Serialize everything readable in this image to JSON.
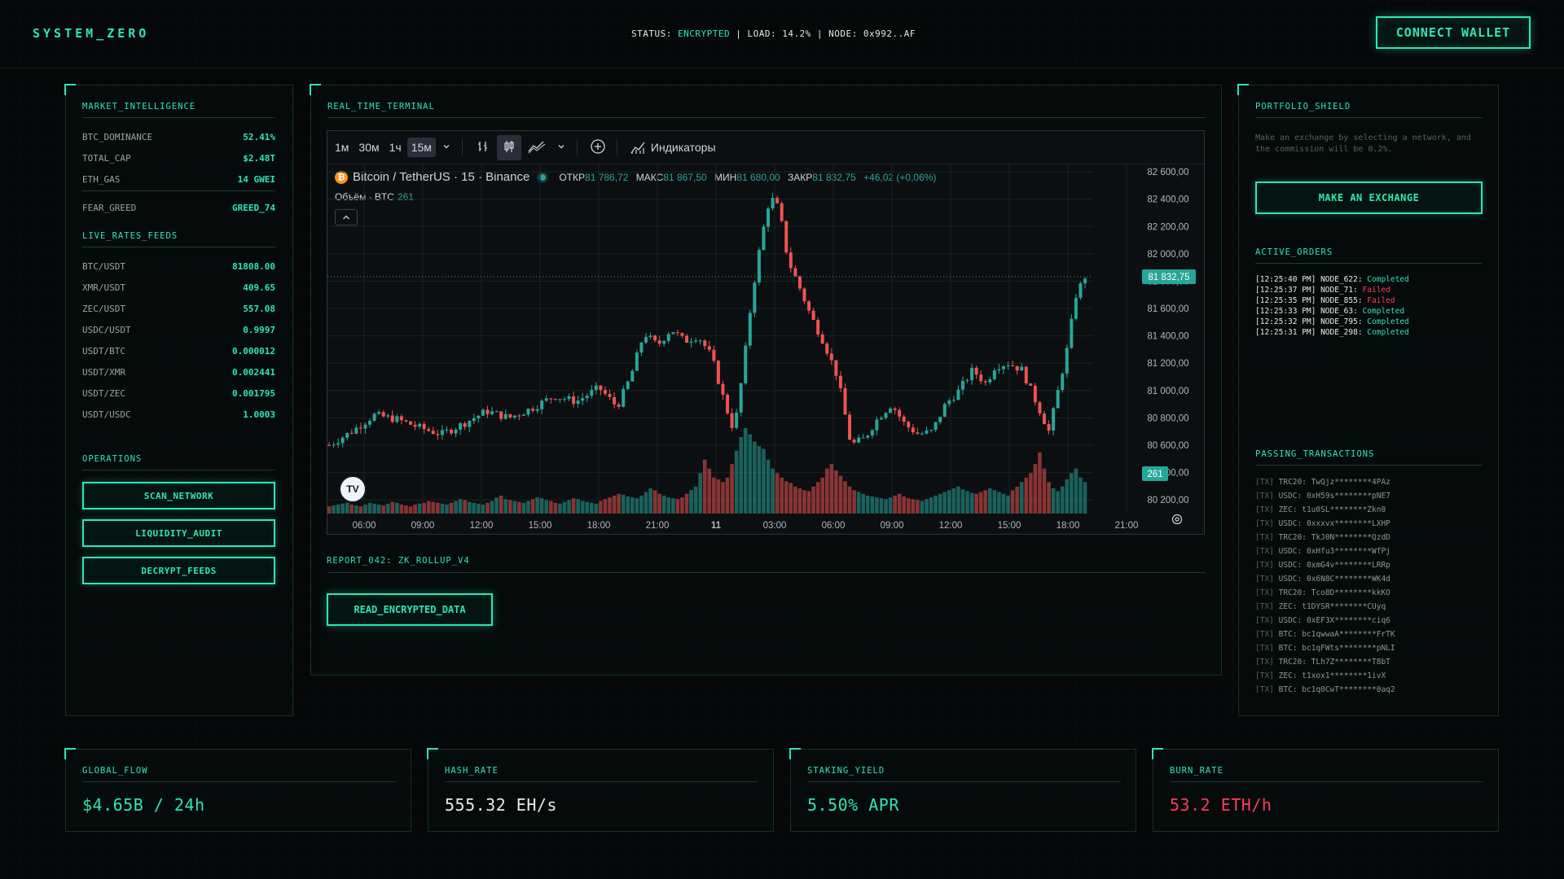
{
  "header": {
    "brand": "SYSTEM_ZERO",
    "status_prefix": "STATUS: ",
    "status_value": "ENCRYPTED",
    "status_suffix": " | LOAD: 14.2% | NODE: 0x992..AF",
    "connect_label": "CONNECT WALLET"
  },
  "left": {
    "market_title": "MARKET_INTELLIGENCE",
    "market_rows": [
      {
        "k": "BTC_DOMINANCE",
        "v": "52.41%"
      },
      {
        "k": "TOTAL_CAP",
        "v": "$2.48T"
      },
      {
        "k": "ETH_GAS",
        "v": "14 GWEI"
      },
      {
        "k": "FEAR_GREED",
        "v": "GREED_74"
      }
    ],
    "rates_title": "LIVE_RATES_FEEDS",
    "rates_rows": [
      {
        "k": "BTC/USDT",
        "v": "81808.00"
      },
      {
        "k": "XMR/USDT",
        "v": "409.65"
      },
      {
        "k": "ZEC/USDT",
        "v": "557.08"
      },
      {
        "k": "USDC/USDT",
        "v": "0.9997"
      },
      {
        "k": "USDT/BTC",
        "v": "0.000012"
      },
      {
        "k": "USDT/XMR",
        "v": "0.002441"
      },
      {
        "k": "USDT/ZEC",
        "v": "0.001795"
      },
      {
        "k": "USDT/USDC",
        "v": "1.0003"
      }
    ],
    "ops_title": "OPERATIONS",
    "ops_buttons": [
      "SCAN_NETWORK",
      "LIQUIDITY_AUDIT",
      "DECRYPT_FEEDS"
    ]
  },
  "center": {
    "title": "REAL_TIME_TERMINAL",
    "report_title": "REPORT_042: ZK_ROLLUP_V4",
    "read_button": "READ_ENCRYPTED_DATA"
  },
  "chart_toolbar": {
    "intervals": [
      "1м",
      "30м",
      "1ч",
      "15м"
    ],
    "indicators": "Индикаторы"
  },
  "chart_legend": {
    "symbol": "Bitcoin / TetherUS · 15 · Binance",
    "open_label": "ОТКР",
    "open": "81 786,72",
    "high_label": "МАКС",
    "high": "81 867,50",
    "low_label": "МИН",
    "low": "81 680,00",
    "close_label": "ЗАКР",
    "close": "81 832,75",
    "change": "+46,02 (+0,06%)",
    "volume_label": "Объём · BTC",
    "volume": "261",
    "price_tag": "81 832,75",
    "volume_tag": "261"
  },
  "chart_data": {
    "type": "candlestick",
    "x_ticks": [
      "06:00",
      "09:00",
      "12:00",
      "15:00",
      "18:00",
      "21:00",
      "11",
      "03:00",
      "06:00",
      "09:00",
      "12:00",
      "15:00",
      "18:00",
      "21:00"
    ],
    "y_ticks": [
      80200,
      80400,
      80600,
      80800,
      81000,
      81200,
      81400,
      81600,
      81800,
      82000,
      82200,
      82400,
      82600
    ],
    "y_tick_labels": [
      "80 200,00",
      "80 400,00",
      "80 600,00",
      "80 800,00",
      "81 000,00",
      "81 200,00",
      "81 400,00",
      "81 600,00",
      "81 800,00",
      "82 000,00",
      "82 200,00",
      "82 400,00",
      "82 600,00"
    ],
    "ylim": [
      80100,
      82660
    ],
    "last_price": 81832.75,
    "colors": {
      "up": "#26a69a",
      "down": "#ef5350"
    },
    "close_path": [
      [
        0,
        80600
      ],
      [
        5,
        80700
      ],
      [
        10,
        80820
      ],
      [
        15,
        80790
      ],
      [
        20,
        80730
      ],
      [
        25,
        80680
      ],
      [
        30,
        80760
      ],
      [
        35,
        80850
      ],
      [
        40,
        80800
      ],
      [
        45,
        80870
      ],
      [
        50,
        80960
      ],
      [
        55,
        80920
      ],
      [
        60,
        81020
      ],
      [
        64,
        80880
      ],
      [
        67,
        81100
      ],
      [
        70,
        81420
      ],
      [
        73,
        81330
      ],
      [
        76,
        81450
      ],
      [
        79,
        81360
      ],
      [
        82,
        81400
      ],
      [
        85,
        81250
      ],
      [
        88,
        80900
      ],
      [
        90,
        80700
      ],
      [
        92,
        81150
      ],
      [
        94,
        81700
      ],
      [
        96,
        82100
      ],
      [
        98,
        82420
      ],
      [
        100,
        82330
      ],
      [
        102,
        81950
      ],
      [
        104,
        81800
      ],
      [
        107,
        81550
      ],
      [
        110,
        81350
      ],
      [
        113,
        81100
      ],
      [
        116,
        80600
      ],
      [
        119,
        80650
      ],
      [
        122,
        80800
      ],
      [
        125,
        80900
      ],
      [
        128,
        80750
      ],
      [
        131,
        80680
      ],
      [
        134,
        80700
      ],
      [
        137,
        80900
      ],
      [
        140,
        81000
      ],
      [
        143,
        81150
      ],
      [
        146,
        81050
      ],
      [
        148,
        81180
      ],
      [
        151,
        81200
      ],
      [
        154,
        81150
      ],
      [
        156,
        81000
      ],
      [
        158,
        80850
      ],
      [
        160,
        80700
      ],
      [
        162,
        81000
      ],
      [
        164,
        81300
      ],
      [
        166,
        81700
      ],
      [
        168,
        81833
      ]
    ],
    "volume": [
      8,
      9,
      10,
      11,
      12,
      10,
      9,
      8,
      10,
      12,
      11,
      10,
      9,
      11,
      13,
      12,
      10,
      9,
      8,
      10,
      11,
      12,
      14,
      13,
      12,
      11,
      10,
      12,
      14,
      16,
      15,
      13,
      12,
      11,
      10,
      12,
      14,
      18,
      20,
      16,
      15,
      14,
      13,
      12,
      14,
      16,
      18,
      17,
      15,
      14,
      12,
      11,
      13,
      15,
      17,
      16,
      14,
      13,
      12,
      11,
      14,
      16,
      18,
      20,
      22,
      21,
      19,
      18,
      17,
      20,
      24,
      28,
      26,
      22,
      20,
      18,
      17,
      16,
      18,
      22,
      26,
      30,
      45,
      60,
      50,
      40,
      38,
      35,
      40,
      55,
      70,
      85,
      95,
      88,
      80,
      75,
      72,
      60,
      50,
      45,
      40,
      36,
      34,
      30,
      28,
      26,
      25,
      30,
      35,
      40,
      50,
      55,
      48,
      42,
      36,
      30,
      26,
      24,
      22,
      20,
      19,
      18,
      17,
      16,
      18,
      20,
      22,
      19,
      17,
      16,
      15,
      14,
      16,
      18,
      20,
      22,
      24,
      26,
      28,
      30,
      27,
      25,
      23,
      22,
      24,
      26,
      28,
      26,
      24,
      22,
      20,
      26,
      30,
      35,
      40,
      45,
      55,
      68,
      50,
      35,
      28,
      25,
      30,
      38,
      45,
      50,
      40,
      35
    ]
  },
  "right": {
    "shield_title": "PORTFOLIO_SHIELD",
    "shield_desc": "Make an exchange by selecting a network, and the commission will be 0.2%.",
    "exchange_button": "MAKE AN EXCHANGE",
    "orders_title": "ACTIVE_ORDERS",
    "orders": [
      {
        "time": "[12:25:40 PM] NODE_622: ",
        "status": "Completed",
        "ok": true
      },
      {
        "time": "[12:25:37 PM] NODE_71: ",
        "status": "Failed",
        "ok": false
      },
      {
        "time": "[12:25:35 PM] NODE_855: ",
        "status": "Failed",
        "ok": false
      },
      {
        "time": "[12:25:33 PM] NODE_63: ",
        "status": "Completed",
        "ok": true
      },
      {
        "time": "[12:25:32 PM] NODE_795: ",
        "status": "Completed",
        "ok": true
      },
      {
        "time": "[12:25:31 PM] NODE_298: ",
        "status": "Completed",
        "ok": true
      }
    ],
    "tx_title": "PASSING_TRANSACTIONS",
    "tx_tag": "[TX]",
    "transactions": [
      "TRC20: TwQjz********4PAz",
      "USDC: 0xH59s********pNE7",
      "ZEC: t1u0SL********Zkn0",
      "USDC: 0xxxvx********LXHP",
      "TRC20: TkJ0N********QzdD",
      "USDC: 0xHfu3********WfPj",
      "USDC: 0xmG4v********LRRp",
      "USDC: 0x6N8C********WK4d",
      "TRC20: Tco8D********kkKO",
      "ZEC: t1DYSR********CUyq",
      "USDC: 0xEF3X********ciq6",
      "BTC: bc1qwwaA********FrTK",
      "BTC: bc1qFWts********pNLI",
      "TRC20: TLh7Z********T8bT",
      "ZEC: t1xox1********1ivX",
      "BTC: bc1q0CwT********0aq2"
    ]
  },
  "kpis": [
    {
      "title": "GLOBAL_FLOW",
      "value": "$4.65B / 24h",
      "color": "#2ee6b8"
    },
    {
      "title": "HASH_RATE",
      "value": "555.32 EH/s",
      "color": "#e6ecea"
    },
    {
      "title": "STAKING_YIELD",
      "value": "5.50% APR",
      "color": "#2ee6b8"
    },
    {
      "title": "BURN_RATE",
      "value": "53.2 ETH/h",
      "color": "#ff3b5c"
    }
  ]
}
